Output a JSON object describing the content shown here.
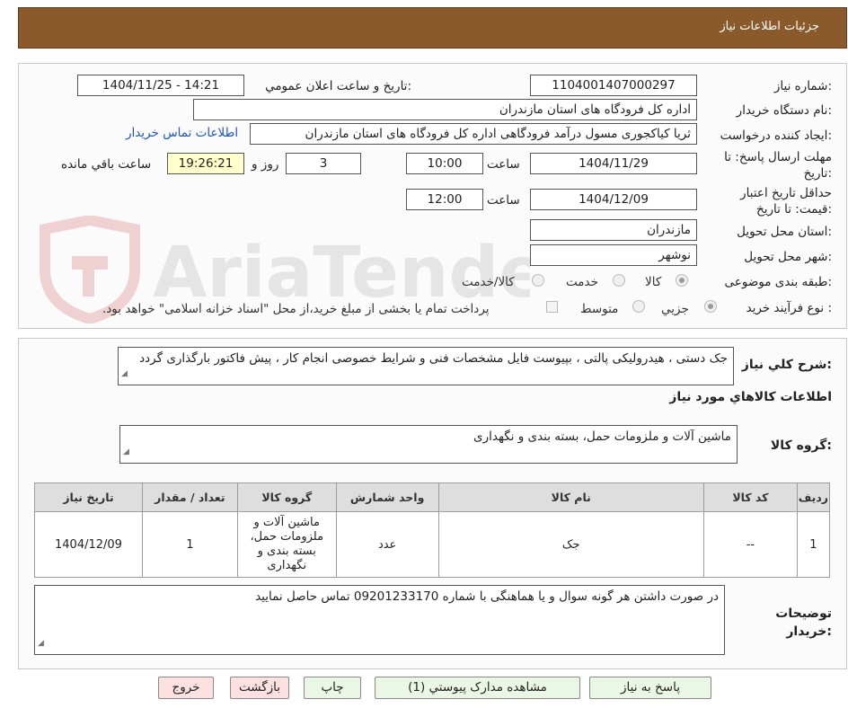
{
  "header": {
    "title": "جزئیات اطلاعات نیاز"
  },
  "watermark": {
    "text": "AriaTender.neT"
  },
  "form": {
    "need_number_label": "شماره نیاز:",
    "need_number": "1104001407000297",
    "announce_label": "تاریخ و ساعت اعلان عمومي:",
    "announce_value": "1404/11/25 - 14:21",
    "buyer_org_label": "نام دستگاه خريدار:",
    "buyer_org": "اداره کل فرودگاه های استان مازندران",
    "requester_label": "ايجاد کننده درخواست:",
    "requester": "ثریا کیاکجوری مسول درآمد فرودگاهی اداره کل فرودگاه های استان مازندران",
    "contact_link": "اطلاعات تماس خريدار",
    "deadline_label": "مهلت ارسال پاسخ: تا تاريخ:",
    "deadline_date": "1404/11/29",
    "time_label": "ساعت",
    "deadline_time": "10:00",
    "days_value": "3",
    "days_label": "روز و",
    "remaining_time": "19:26:21",
    "remaining_label": "ساعت باقي مانده",
    "validity_label": "حداقل تاريخ اعتبار قيمت: تا تاريخ:",
    "validity_date": "1404/12/09",
    "validity_time": "12:00",
    "province_label": "استان محل تحويل:",
    "province": "مازندران",
    "city_label": "شهر محل تحويل:",
    "city": "نوشهر",
    "category_label": "طبقه بندی موضوعی:",
    "category_options": [
      "کالا",
      "خدمت",
      "کالا/خدمت"
    ],
    "process_label": "نوع فرآيند خريد :",
    "process_options": [
      "جزيي",
      "متوسط"
    ],
    "payment_note": "پرداخت تمام يا بخشی از مبلغ خريد،از محل \"اسناد خزانه اسلامی\" خواهد بود."
  },
  "details": {
    "description_label": "شرح کلي نياز:",
    "description": "جک دستی ، هیدرولیکی پالتی ، بپیوست فایل مشخصات فنی و شرایط خصوصی انجام کار ، پیش فاکتور بارگذاری گردد",
    "goods_info_title": "اطلاعات کالاهاي مورد نياز",
    "goods_group_label": "گروه کالا:",
    "goods_group": "ماشین آلات و ملزومات حمل، بسته بندی و نگهداری",
    "table": {
      "headers": [
        "رديف",
        "کد کالا",
        "نام کالا",
        "واحد شمارش",
        "گروه کالا",
        "تعداد / مقدار",
        "تاريخ نياز"
      ],
      "rows": [
        [
          "1",
          "--",
          "جک",
          "عدد",
          "ماشین آلات و ملزومات حمل، بسته بندی و نگهداری",
          "1",
          "1404/12/09"
        ]
      ]
    },
    "buyer_notes_label": "توضيحات خريدار:",
    "buyer_notes": "در صورت داشتن هر گونه سوال و یا هماهنگی با شماره 09201233170 تماس حاصل نمایید"
  },
  "buttons": {
    "reply": "پاسخ به نياز",
    "attachments": "مشاهده مدارک پيوستي (1)",
    "print": "چاپ",
    "back": "بازگشت",
    "exit": "خروج"
  }
}
